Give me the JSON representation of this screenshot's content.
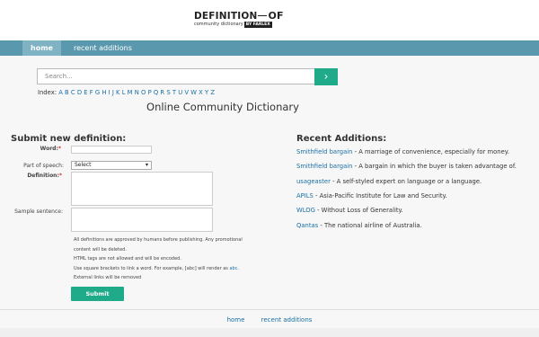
{
  "logo": {
    "brand_left": "DEFINITION",
    "brand_right": "OF",
    "tagline": "community dictionary",
    "by": "BY FARLEX"
  },
  "nav": {
    "home": "home",
    "recent": "recent additions"
  },
  "search": {
    "placeholder": "Search...",
    "button_icon": "chevron-right-icon",
    "button_glyph": "›"
  },
  "index": {
    "label": "Index:",
    "letters": [
      "A",
      "B",
      "C",
      "D",
      "E",
      "F",
      "G",
      "H",
      "I",
      "J",
      "K",
      "L",
      "M",
      "N",
      "O",
      "P",
      "Q",
      "R",
      "S",
      "T",
      "U",
      "V",
      "W",
      "X",
      "Y",
      "Z"
    ]
  },
  "page_title": "Online Community Dictionary",
  "form": {
    "title": "Submit new definition:",
    "word_label": "Word:",
    "pos_label": "Part of speech:",
    "pos_value": "Select",
    "definition_label": "Definition:",
    "sample_label": "Sample sentence:",
    "required_mark": "*",
    "notes": [
      "All definitions are approved by humans before publishing. Any promotional",
      "content will be deleted.",
      "HTML tags are not allowed and will be encoded.",
      "Use square brackets to link a word. For example, [abc] will render as ",
      "External links will be removed"
    ],
    "abc_link": "abc",
    "submit": "Submit"
  },
  "recent": {
    "title": "Recent Additions:",
    "items": [
      {
        "term": "Smithfield bargain",
        "def": " - A marriage of convenience, especially for money."
      },
      {
        "term": "Smithfield bargain",
        "def": " - A bargain in which the buyer is taken advantage of."
      },
      {
        "term": "usageaster",
        "def": " - A self-styled expert on language or a language."
      },
      {
        "term": "APILS",
        "def": " - Asia-Pacific Institute for Law and Security."
      },
      {
        "term": "WLOG",
        "def": " - Without Loss of Generality."
      },
      {
        "term": "Qantas",
        "def": " - The national airline of Australia."
      }
    ]
  },
  "footer": {
    "home": "home",
    "recent": "recent additions"
  },
  "colors": {
    "nav_bar": "#5a98ad",
    "accent": "#1faa89",
    "link": "#1a6fa3"
  }
}
